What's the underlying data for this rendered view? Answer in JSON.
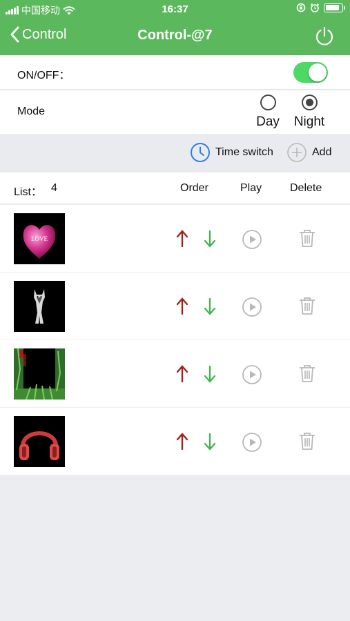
{
  "status_bar": {
    "carrier": "中国移动",
    "time": "16:37",
    "battery_level": 0.85
  },
  "nav": {
    "back_label": "Control",
    "title": "Control-@7",
    "icons": [
      "chevron-left-icon",
      "power-icon"
    ]
  },
  "onoff": {
    "label": "ON/OFF：",
    "state": true
  },
  "mode": {
    "label": "Mode",
    "options": [
      "Day",
      "Night"
    ],
    "selected": "Night"
  },
  "toolbar": {
    "time_switch_label": "Time switch",
    "add_label": "Add"
  },
  "list": {
    "label": "List：",
    "count": "4",
    "columns": {
      "order": "Order",
      "play": "Play",
      "delete": "Delete"
    },
    "items": [
      {
        "thumbnail": "pink-heart",
        "thumb_text": "LOVE"
      },
      {
        "thumbnail": "wolf"
      },
      {
        "thumbnail": "grass-frame"
      },
      {
        "thumbnail": "red-headphones"
      }
    ]
  },
  "colors": {
    "header_green": "#5cb85c",
    "toggle_green": "#4cd964",
    "up_arrow_red": "#a3211c",
    "down_arrow_green": "#3cb54a",
    "clock_blue": "#2b7de9",
    "icon_gray": "#b8b8b8"
  }
}
